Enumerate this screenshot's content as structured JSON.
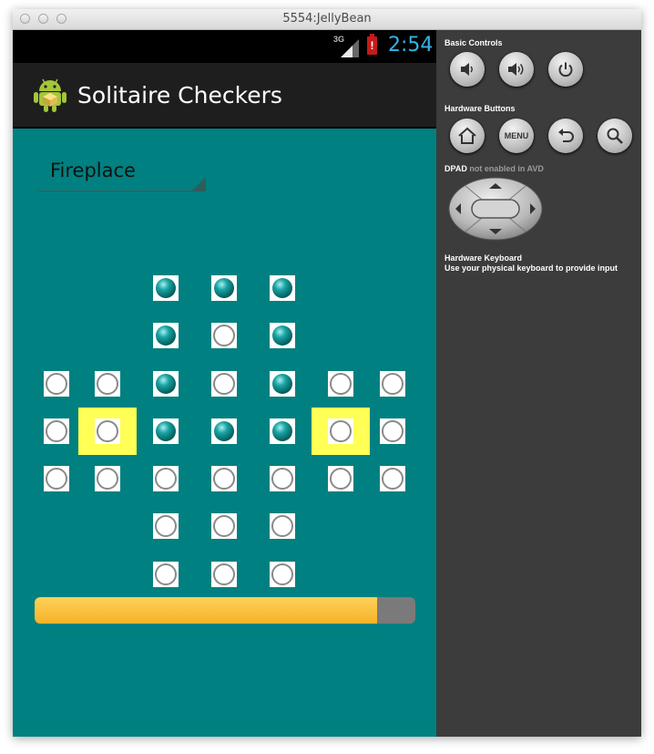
{
  "window": {
    "title": "5554:JellyBean"
  },
  "statusbar": {
    "network": "3G",
    "battery_alert": "!",
    "time": "2:54"
  },
  "app": {
    "title": "Solitaire Checkers"
  },
  "spinner": {
    "selected": "Fireplace"
  },
  "board": {
    "rows": [
      "..xxx..",
      "..xox..",
      "ooxoxoo",
      "ooxxxoo",
      "ooooooo",
      "..ooo..",
      "..ooo.."
    ],
    "highlighted": [
      [
        3,
        1
      ],
      [
        3,
        5
      ]
    ]
  },
  "progress": {
    "fraction": 0.9
  },
  "panel": {
    "basic_controls": "Basic Controls",
    "hardware_buttons": "Hardware Buttons",
    "dpad_label": "DPAD",
    "dpad_status": "not enabled in AVD",
    "keyboard_title": "Hardware Keyboard",
    "keyboard_hint": "Use your physical keyboard to provide input",
    "menu_label": "MENU"
  },
  "icons": {
    "volume_down": "volume-down-icon",
    "volume_up": "volume-up-icon",
    "power": "power-icon",
    "home": "home-icon",
    "back": "back-icon",
    "search": "search-icon"
  },
  "colors": {
    "screen_bg": "#008080",
    "highlight": "#ffff55",
    "clock": "#33b5e5",
    "progress": "#f5b227"
  }
}
